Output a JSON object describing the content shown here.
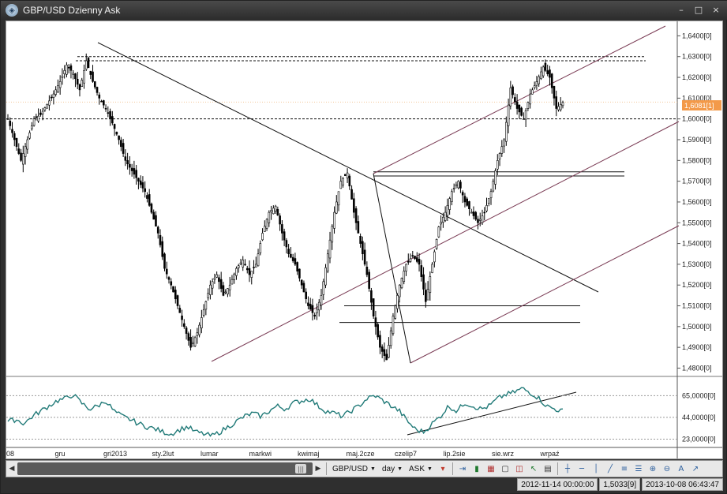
{
  "window": {
    "title": "GBP/USD Dzienny Ask",
    "controls": {
      "minimize": "–",
      "restore": "□",
      "close": "×"
    }
  },
  "price_axis": {
    "labels": [
      "1,6400[0]",
      "1,6300[0]",
      "1,6200[0]",
      "1,6100[0]",
      "1,6000[0]",
      "1,5900[0]",
      "1,5800[0]",
      "1,5700[0]",
      "1,5600[0]",
      "1,5500[0]",
      "1,5400[0]",
      "1,5300[0]",
      "1,5200[0]",
      "1,5100[0]",
      "1,5000[0]",
      "1,4900[0]",
      "1,4800[0]"
    ],
    "current_price_label": "1,6081[1]"
  },
  "indicator_axis": {
    "labels": [
      "65,0000[0]",
      "44,0000[0]",
      "23,0000[0]"
    ]
  },
  "time_axis": {
    "labels": [
      "08",
      "gru",
      "gri2013",
      "sty.2lut",
      "lumar",
      "markwi",
      "kwimaj",
      "maj.2cze",
      "czelip7",
      "lip.2sie",
      "sie.wrz",
      "wrpaź"
    ]
  },
  "toolbar": {
    "instrument": "GBP/USD",
    "period": "day",
    "side": "ASK"
  },
  "status": {
    "cursor_time": "2012-11-14 00:00:00",
    "cursor_value": "1,5033[9]",
    "server_time": "2013-10-08 06:43:47"
  },
  "colors": {
    "accent_price_tag": "#f39a4a",
    "indicator_line": "#217a78",
    "channel_line": "#7a3b54"
  },
  "chart_data": {
    "type": "candlestick",
    "instrument": "GBP/USD",
    "ylim": [
      1.476,
      1.647
    ],
    "price_path": [
      [
        0,
        1.6
      ],
      [
        3,
        1.59
      ],
      [
        6,
        1.58
      ],
      [
        9,
        1.59
      ],
      [
        12,
        1.6
      ],
      [
        15,
        1.602
      ],
      [
        18,
        1.607
      ],
      [
        21,
        1.612
      ],
      [
        24,
        1.618
      ],
      [
        27,
        1.626
      ],
      [
        30,
        1.622
      ],
      [
        33,
        1.614
      ],
      [
        36,
        1.628
      ],
      [
        39,
        1.618
      ],
      [
        42,
        1.61
      ],
      [
        45,
        1.605
      ],
      [
        48,
        1.598
      ],
      [
        51,
        1.59
      ],
      [
        54,
        1.58
      ],
      [
        57,
        1.575
      ],
      [
        60,
        1.57
      ],
      [
        63,
        1.565
      ],
      [
        66,
        1.555
      ],
      [
        69,
        1.545
      ],
      [
        72,
        1.528
      ],
      [
        75,
        1.52
      ],
      [
        78,
        1.51
      ],
      [
        81,
        1.5
      ],
      [
        84,
        1.49
      ],
      [
        87,
        1.497
      ],
      [
        90,
        1.508
      ],
      [
        93,
        1.52
      ],
      [
        96,
        1.525
      ],
      [
        99,
        1.515
      ],
      [
        102,
        1.52
      ],
      [
        105,
        1.528
      ],
      [
        108,
        1.532
      ],
      [
        111,
        1.525
      ],
      [
        114,
        1.53
      ],
      [
        117,
        1.545
      ],
      [
        120,
        1.555
      ],
      [
        123,
        1.558
      ],
      [
        126,
        1.545
      ],
      [
        129,
        1.535
      ],
      [
        132,
        1.53
      ],
      [
        135,
        1.52
      ],
      [
        138,
        1.51
      ],
      [
        141,
        1.505
      ],
      [
        144,
        1.515
      ],
      [
        147,
        1.535
      ],
      [
        150,
        1.555
      ],
      [
        153,
        1.57
      ],
      [
        156,
        1.574
      ],
      [
        159,
        1.555
      ],
      [
        162,
        1.54
      ],
      [
        165,
        1.525
      ],
      [
        168,
        1.505
      ],
      [
        171,
        1.49
      ],
      [
        174,
        1.484
      ],
      [
        177,
        1.505
      ],
      [
        180,
        1.52
      ],
      [
        183,
        1.53
      ],
      [
        186,
        1.534
      ],
      [
        189,
        1.53
      ],
      [
        192,
        1.512
      ],
      [
        195,
        1.53
      ],
      [
        198,
        1.548
      ],
      [
        201,
        1.555
      ],
      [
        204,
        1.565
      ],
      [
        207,
        1.57
      ],
      [
        210,
        1.56
      ],
      [
        213,
        1.555
      ],
      [
        216,
        1.55
      ],
      [
        219,
        1.555
      ],
      [
        222,
        1.565
      ],
      [
        225,
        1.58
      ],
      [
        228,
        1.59
      ],
      [
        231,
        1.615
      ],
      [
        234,
        1.605
      ],
      [
        237,
        1.6
      ],
      [
        240,
        1.612
      ],
      [
        243,
        1.618
      ],
      [
        246,
        1.625
      ],
      [
        249,
        1.62
      ],
      [
        252,
        1.605
      ],
      [
        255,
        1.608
      ]
    ],
    "horizontal_levels": [
      1.63,
      1.628,
      1.6,
      1.5745,
      1.5725,
      1.51,
      1.502
    ],
    "current_price": 1.6081,
    "indicator": {
      "ylim": [
        15,
        82
      ],
      "levels": [
        65,
        44,
        23
      ],
      "values": [
        40,
        42,
        38,
        45,
        50,
        55,
        60,
        62,
        66,
        58,
        52,
        55,
        60,
        50,
        45,
        42,
        38,
        35,
        33,
        30,
        28,
        32,
        35,
        30,
        28,
        26,
        30,
        35,
        40,
        45,
        48,
        45,
        50,
        55,
        52,
        58,
        60,
        62,
        55,
        50,
        48,
        45,
        50,
        55,
        62,
        65,
        60,
        55,
        50,
        40,
        32,
        30,
        38,
        45,
        55,
        50,
        58,
        55,
        52,
        55,
        62,
        66,
        68,
        72,
        68,
        63,
        55,
        52,
        50
      ]
    }
  }
}
